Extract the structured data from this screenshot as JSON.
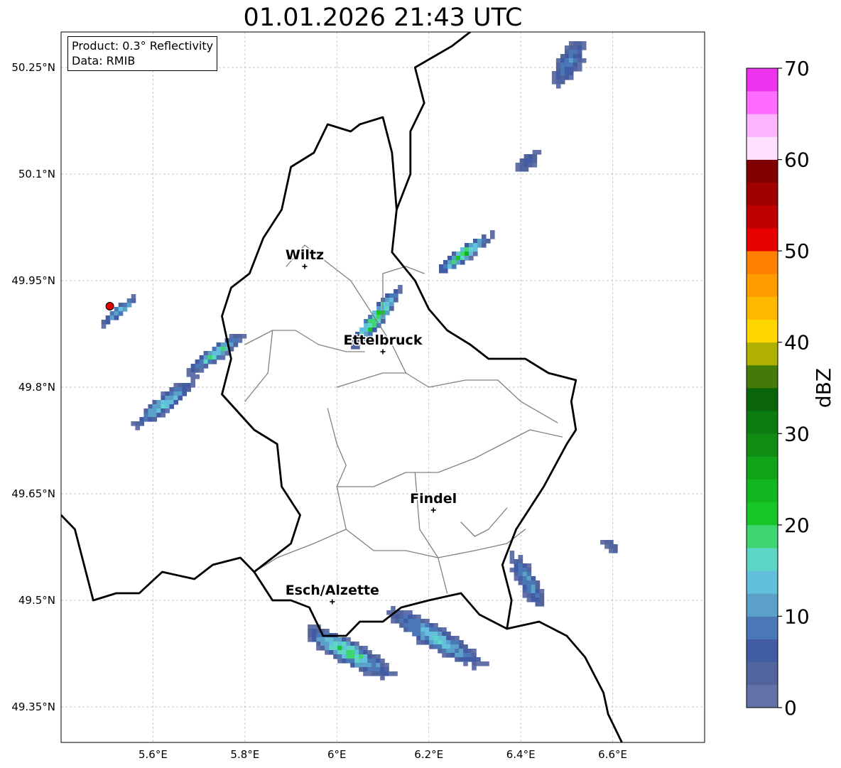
{
  "title": "01.01.2026 21:43 UTC",
  "info": {
    "product": "Product: 0.3° Reflectivity",
    "source": "Data: RMIB"
  },
  "map": {
    "lon_range": [
      5.4,
      6.8
    ],
    "lat_range": [
      49.3,
      50.3
    ],
    "lon_ticks": [
      {
        "value": 5.6,
        "label": "5.6°E"
      },
      {
        "value": 5.8,
        "label": "5.8°E"
      },
      {
        "value": 6.0,
        "label": "6°E"
      },
      {
        "value": 6.2,
        "label": "6.2°E"
      },
      {
        "value": 6.4,
        "label": "6.4°E"
      },
      {
        "value": 6.6,
        "label": "6.6°E"
      }
    ],
    "lat_ticks": [
      {
        "value": 50.25,
        "label": "50.25°N"
      },
      {
        "value": 50.1,
        "label": "50.1°N"
      },
      {
        "value": 49.95,
        "label": "49.95°N"
      },
      {
        "value": 49.8,
        "label": "49.8°N"
      },
      {
        "value": 49.65,
        "label": "49.65°N"
      },
      {
        "value": 49.5,
        "label": "49.5°N"
      },
      {
        "value": 49.35,
        "label": "49.35°N"
      }
    ],
    "cities": [
      {
        "name": "Wiltz",
        "lon": 5.93,
        "lat": 49.97
      },
      {
        "name": "Ettelbruck",
        "lon": 6.1,
        "lat": 49.85
      },
      {
        "name": "Findel",
        "lon": 6.21,
        "lat": 49.627
      },
      {
        "name": "Esch/Alzette",
        "lon": 5.99,
        "lat": 49.498
      }
    ],
    "radar_site": {
      "lon": 5.506,
      "lat": 49.914,
      "color": "#dd0000"
    },
    "border_color": "#000000",
    "canton_color": "#808080"
  },
  "colorbar": {
    "label": "dBZ",
    "min": 0,
    "max": 70,
    "ticks": [
      0,
      10,
      20,
      30,
      40,
      50,
      60,
      70
    ],
    "colors": [
      "#6272a8",
      "#52649e",
      "#425ca4",
      "#4a78b6",
      "#5ba0c8",
      "#63c0dc",
      "#5ed6c6",
      "#3ed670",
      "#16c628",
      "#12b61e",
      "#12a418",
      "#0f8c14",
      "#0d7c10",
      "#0a640c",
      "#437a08",
      "#b0b000",
      "#ffd700",
      "#ffb800",
      "#ff9c00",
      "#ff8000",
      "#e60000",
      "#c00000",
      "#a00000",
      "#800000",
      "#ffe0ff",
      "#ffb4ff",
      "#ff6cff",
      "#ee33ee"
    ]
  },
  "echoes": [
    {
      "lon": 5.52,
      "lat": 49.91,
      "len": 0.1,
      "wid": 0.02,
      "angle": -40,
      "max_dbz": 18
    },
    {
      "lon": 5.62,
      "lat": 49.78,
      "len": 0.17,
      "wid": 0.035,
      "angle": -38,
      "max_dbz": 16
    },
    {
      "lon": 5.73,
      "lat": 49.85,
      "len": 0.15,
      "wid": 0.03,
      "angle": -35,
      "max_dbz": 18
    },
    {
      "lon": 6.08,
      "lat": 49.9,
      "len": 0.17,
      "wid": 0.035,
      "angle": -52,
      "max_dbz": 24
    },
    {
      "lon": 6.27,
      "lat": 49.99,
      "len": 0.15,
      "wid": 0.03,
      "angle": -35,
      "max_dbz": 22
    },
    {
      "lon": 6.02,
      "lat": 49.43,
      "len": 0.22,
      "wid": 0.05,
      "angle": 28,
      "max_dbz": 20
    },
    {
      "lon": 6.21,
      "lat": 49.45,
      "len": 0.24,
      "wid": 0.05,
      "angle": 30,
      "max_dbz": 15
    },
    {
      "lon": 6.41,
      "lat": 49.53,
      "len": 0.14,
      "wid": 0.04,
      "angle": 60,
      "max_dbz": 12
    },
    {
      "lon": 6.5,
      "lat": 50.26,
      "len": 0.12,
      "wid": 0.05,
      "angle": -60,
      "max_dbz": 10
    },
    {
      "lon": 6.41,
      "lat": 50.12,
      "len": 0.06,
      "wid": 0.03,
      "angle": -40,
      "max_dbz": 8
    },
    {
      "lon": 6.59,
      "lat": 49.58,
      "len": 0.05,
      "wid": 0.02,
      "angle": 40,
      "max_dbz": 6
    }
  ]
}
